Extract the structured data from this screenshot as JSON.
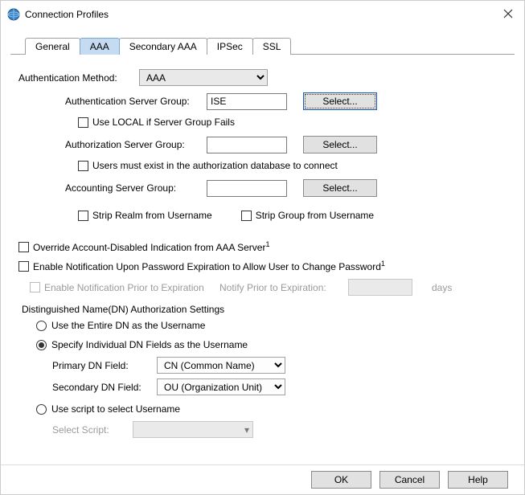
{
  "window": {
    "title": "Connection Profiles"
  },
  "tabs": [
    "General",
    "AAA",
    "Secondary AAA",
    "IPSec",
    "SSL"
  ],
  "active_tab_index": 1,
  "auth_method": {
    "label": "Authentication Method:",
    "value": "AAA"
  },
  "auth_server": {
    "label": "Authentication Server Group:",
    "value": "ISE",
    "select_btn": "Select...",
    "use_local": "Use LOCAL if Server Group Fails"
  },
  "authz_server": {
    "label": "Authorization Server Group:",
    "value": "",
    "select_btn": "Select...",
    "must_exist": "Users must exist in the authorization database to connect"
  },
  "acct_server": {
    "label": "Accounting Server Group:",
    "value": "",
    "select_btn": "Select..."
  },
  "strip": {
    "realm": "Strip Realm from Username",
    "group": "Strip Group from Username"
  },
  "override": "Override Account-Disabled Indication from AAA Server",
  "enable_notify": "Enable Notification Upon Password Expiration to Allow User to Change Password",
  "sup": "1",
  "notify_prior": {
    "label": "Enable Notification Prior to Expiration",
    "days_label": "Notify Prior to Expiration:",
    "days_unit": "days"
  },
  "dn": {
    "title": "Distinguished Name(DN) Authorization Settings",
    "entire": "Use the Entire DN as the Username",
    "specify": "Specify Individual DN Fields as the Username",
    "primary_label": "Primary DN Field:",
    "primary_value": "CN (Common Name)",
    "secondary_label": "Secondary DN Field:",
    "secondary_value": "OU (Organization Unit)",
    "use_script": "Use script to select Username",
    "select_script": "Select Script:"
  },
  "buttons": {
    "ok": "OK",
    "cancel": "Cancel",
    "help": "Help"
  }
}
